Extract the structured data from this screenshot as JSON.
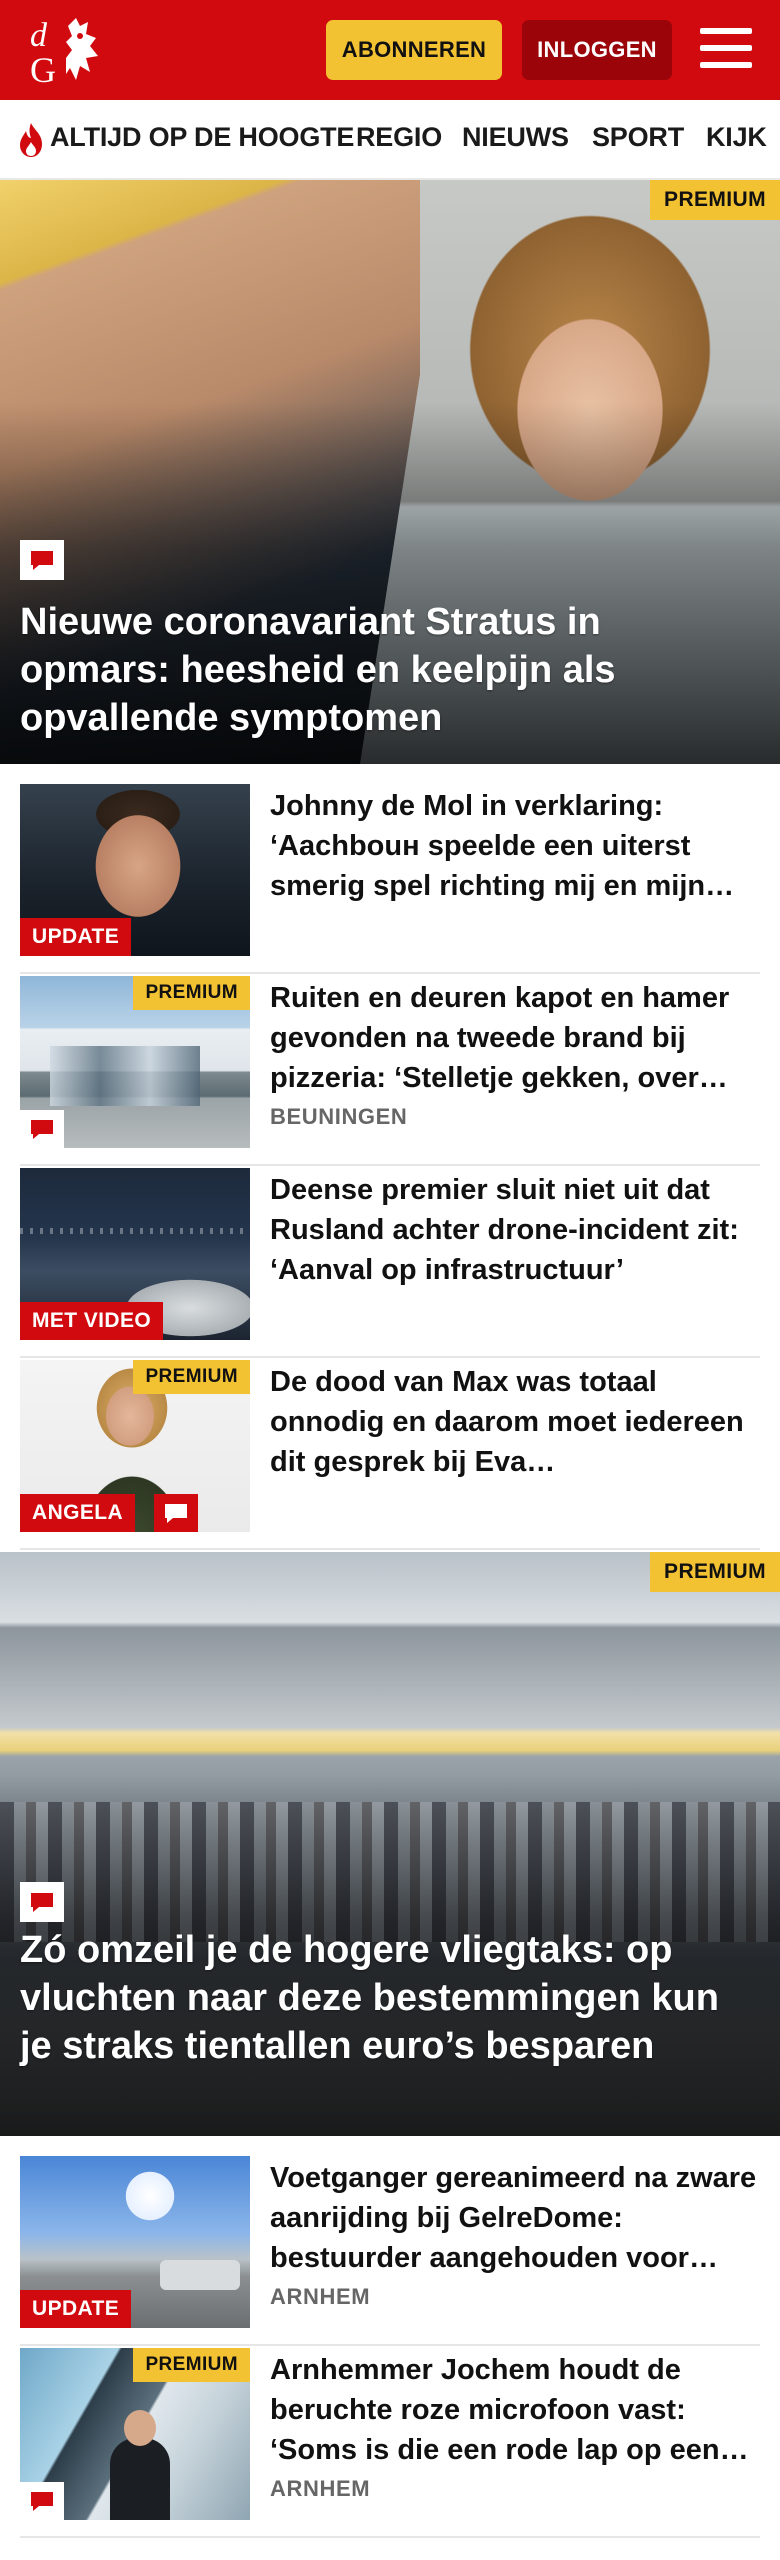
{
  "header": {
    "subscribe_label": "ABONNEREN",
    "login_label": "INLOGGEN",
    "brand_color": "#d00a0f",
    "accent_color": "#f3c232"
  },
  "nav": {
    "items": [
      {
        "label": "ALTIJD OP DE HOOGTE",
        "icon": "flame-icon"
      },
      {
        "label": "REGIO"
      },
      {
        "label": "NIEUWS"
      },
      {
        "label": "SPORT"
      },
      {
        "label": "KIJK"
      }
    ]
  },
  "articles": [
    {
      "type": "hero",
      "title": "Nieuwe coronavariant Stratus in opmars: heesheid en keelpijn als opvallende symptomen",
      "badge": "PREMIUM",
      "comments": true
    },
    {
      "type": "list",
      "title": "Johnny de Mol in verklaring: ‘Aachbouн speelde een uiterst smerig spel richting mij en mijn…",
      "label": "UPDATE"
    },
    {
      "type": "list",
      "title": "Ruiten en deuren kapot en hamer gevonden na tweede brand bij pizzeria: ‘Stelletje gekken, over…",
      "badge": "PREMIUM",
      "region": "BEUNINGEN",
      "comments": true
    },
    {
      "type": "list",
      "title": "Deense premier sluit niet uit dat Rusland achter drone-incident zit: ‘Aanval op infrastructuur’",
      "label": "MET VIDEO"
    },
    {
      "type": "list",
      "title": "De dood van Max was totaal onnodig en daarom moet iedereen dit gesprek bij Eva…",
      "badge": "PREMIUM",
      "label": "ANGELA",
      "comments": true
    },
    {
      "type": "hero",
      "title": "Zó omzeil je de hogere vliegtaks: op vluchten naar deze bestemmingen kun je straks tientallen euro’s besparen",
      "badge": "PREMIUM",
      "comments": true
    },
    {
      "type": "list",
      "title": "Voetganger gereanimeerd na zware aanrijding bij GelreDome: bestuurder aangehouden voor…",
      "label": "UPDATE",
      "region": "ARNHEM"
    },
    {
      "type": "list",
      "title": "Arnhemmer Jochem houdt de beruchte roze microfoon vast: ‘Soms is die een rode lap op een…",
      "badge": "PREMIUM",
      "region": "ARNHEM",
      "comments": true
    }
  ]
}
